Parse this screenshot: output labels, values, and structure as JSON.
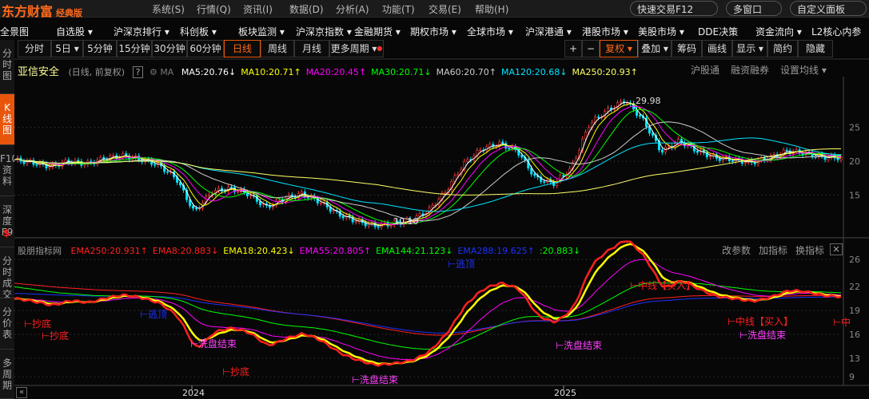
{
  "app": {
    "logo": "东方财富",
    "edition": "经典版"
  },
  "top_menu": [
    "系统(S)",
    "行情(Q)",
    "资讯(I)",
    "数据(D)",
    "分析(A)",
    "功能(T)",
    "交易(E)",
    "帮助(H)"
  ],
  "top_buttons": [
    "快速交易F12",
    "多窗口",
    "自定义面板"
  ],
  "nav_menu": [
    "全景图",
    "自选股 ▾",
    "沪深京排行 ▾",
    "科创板 ▾",
    "板块监测 ▾",
    "沪深京指数 ▾",
    "金融期货 ▾",
    "期权市场 ▾",
    "全球市场 ▾",
    "沪深港通 ▾",
    "港股市场 ▾",
    "美股市场 ▾",
    "DDE决策",
    "资金流向 ▾",
    "L2核心内参"
  ],
  "sidebar": [
    {
      "label": "分时图"
    },
    {
      "label": "K线图",
      "active": true
    },
    {
      "label": "F10资料"
    },
    {
      "label": "深度F9"
    },
    {
      "label": "分时成交"
    },
    {
      "label": "分价表"
    },
    {
      "label": "多周期"
    }
  ],
  "periods": [
    "分时",
    "5日 ▾",
    "5分钟",
    "15分钟",
    "30分钟",
    "60分钟",
    "日线",
    "周线",
    "月线",
    "更多周期 ▾"
  ],
  "active_period": "日线",
  "right_tools": [
    "+",
    "−",
    "复权 ▾",
    "叠加 ▾",
    "筹码",
    "画线",
    "显示 ▾",
    "简约",
    "隐藏"
  ],
  "stock": {
    "name": "亚信安全",
    "mode": "(日线, 前复权)",
    "help": "?",
    "ma_label": "MA"
  },
  "ma_legend": [
    {
      "text": "MA5:20.76",
      "arrow": "↓",
      "color": "#ffffff"
    },
    {
      "text": "MA10:20.71",
      "arrow": "↑",
      "color": "#ffff00"
    },
    {
      "text": "MA20:20.45",
      "arrow": "↑",
      "color": "#ff00ff"
    },
    {
      "text": "MA30:20.71",
      "arrow": "↓",
      "color": "#00ff00"
    },
    {
      "text": "MA60:20.70",
      "arrow": "↑",
      "color": "#cccccc"
    },
    {
      "text": "MA120:20.68",
      "arrow": "↓",
      "color": "#00e5ff"
    },
    {
      "text": "MA250:20.93",
      "arrow": "↑",
      "color": "#ffff66"
    }
  ],
  "main_links": [
    "沪股通",
    "融资融券",
    "设置均线 ▾"
  ],
  "main_annotations": {
    "high": "29.98",
    "low": "10.10"
  },
  "indicator": {
    "name": "股朋指标网",
    "legend": [
      {
        "text": "EMA250:20.931",
        "arrow": "↑",
        "color": "#ff2020"
      },
      {
        "text": "EMA8:20.883",
        "arrow": "↓",
        "color": "#ff2020"
      },
      {
        "text": "EMA18:20.423",
        "arrow": "↓",
        "color": "#ffff00"
      },
      {
        "text": "EMA55:20.805",
        "arrow": "↑",
        "color": "#ff00ff"
      },
      {
        "text": "EMA144:21.123",
        "arrow": "↓",
        "color": "#00ff00"
      },
      {
        "text": "EMA288:19.625",
        "arrow": "↑",
        "color": "#2030ff"
      },
      {
        "text": ":20.883",
        "arrow": "↓",
        "color": "#00ff00"
      }
    ],
    "links": [
      "改参数",
      "加指标",
      "换指标"
    ],
    "close": "×"
  },
  "signals": [
    {
      "text": "抄底",
      "color": "#ff2020"
    },
    {
      "text": "抄底",
      "color": "#ff2020"
    },
    {
      "text": "逃顶",
      "color": "#2030ff"
    },
    {
      "text": "洗盘结束",
      "color": "#ff40ff"
    },
    {
      "text": "抄底",
      "color": "#ff2020"
    },
    {
      "text": "洗盘结束",
      "color": "#ff40ff"
    },
    {
      "text": "洗盘结束",
      "color": "#ff40ff"
    },
    {
      "text": "逃顶",
      "color": "#2030ff"
    },
    {
      "text": "中线【买入】",
      "color": "#ff2020"
    },
    {
      "text": "中线【买入】",
      "color": "#ff2020"
    },
    {
      "text": "洗盘结束",
      "color": "#ff40ff"
    },
    {
      "text": "中",
      "color": "#ff2020"
    }
  ],
  "chart_data": {
    "type": "line",
    "price_axis": {
      "ticks": [
        "25",
        "20",
        "15"
      ],
      "ylim": [
        9,
        31
      ]
    },
    "indicator_axis": {
      "ticks": [
        "26",
        "22",
        "19",
        "16",
        "13",
        "9"
      ],
      "ylim": [
        8,
        27
      ]
    },
    "x_ticks": [
      "2024",
      "2025"
    ],
    "close": [
      20.2,
      19.8,
      19.2,
      20.0,
      19.6,
      20.4,
      20.8,
      20.3,
      19.5,
      17.5,
      12.5,
      15.5,
      16.0,
      15.2,
      13.2,
      14.5,
      15.2,
      14.0,
      12.2,
      11.2,
      10.5,
      10.8,
      11.2,
      12.6,
      15.5,
      19.6,
      21.8,
      22.6,
      21.5,
      17.5,
      16.7,
      19.0,
      25.5,
      27.5,
      29.0,
      26.0,
      21.4,
      23.0,
      21.5,
      20.5,
      20.2,
      19.8,
      20.5,
      21.5,
      21.2,
      20.6,
      20.5
    ]
  }
}
